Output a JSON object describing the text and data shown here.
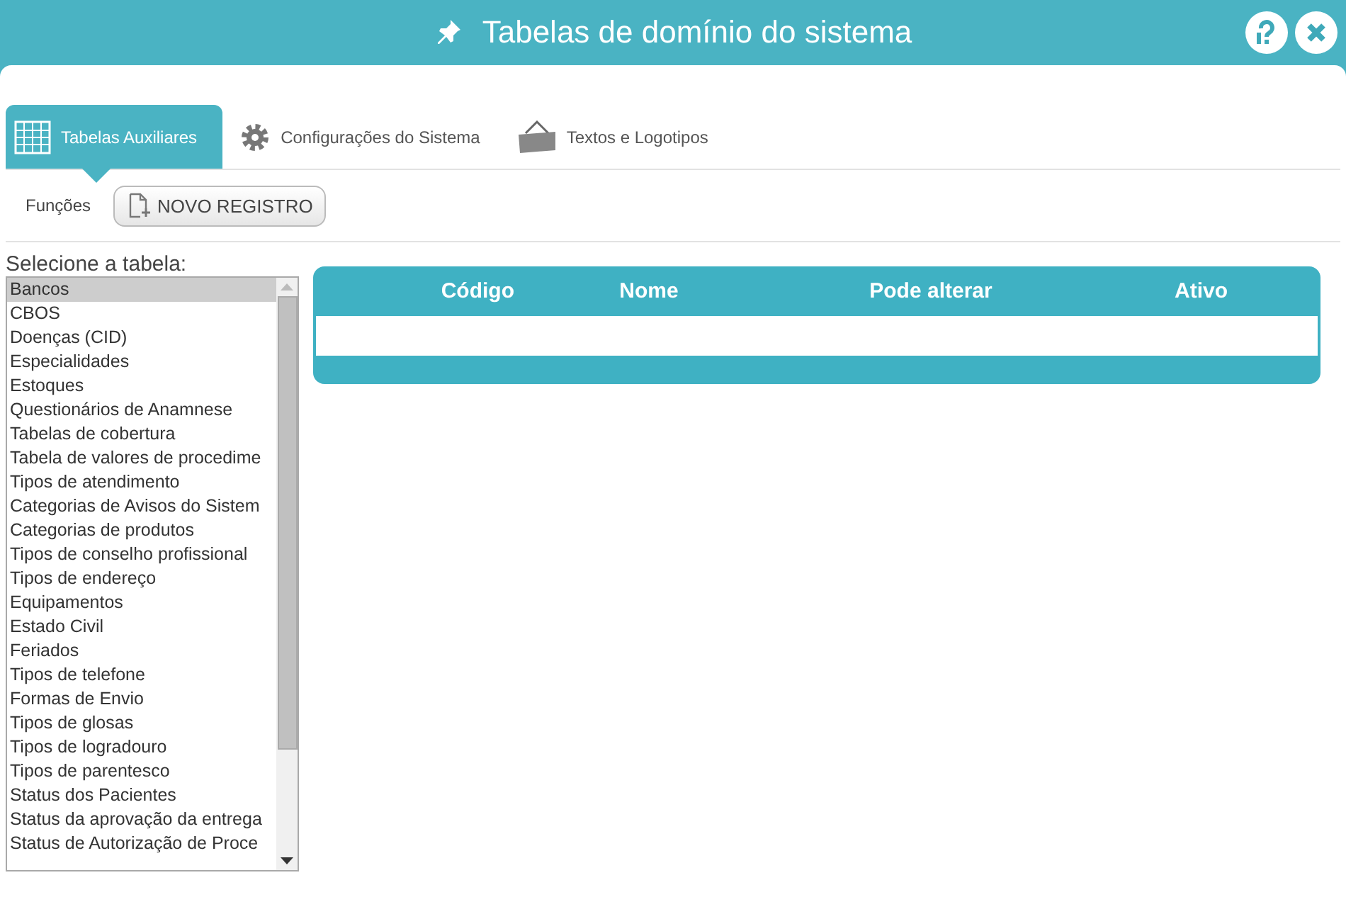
{
  "window": {
    "title": "Tabelas de domínio do sistema"
  },
  "tabs": [
    {
      "label": "Tabelas Auxiliares",
      "kind": "grid",
      "selected": true
    },
    {
      "label": "Configurações do Sistema",
      "kind": "gear",
      "selected": false
    },
    {
      "label": "Textos e Logotipos",
      "kind": "sign",
      "selected": false
    }
  ],
  "toolbar": {
    "label": "Funções",
    "button": "NOVO REGISTRO"
  },
  "table_list": {
    "label": "Selecione a tabela:",
    "items": [
      {
        "label": "Bancos",
        "selected": true
      },
      {
        "label": "CBOS",
        "selected": false
      },
      {
        "label": "Doenças (CID)",
        "selected": false
      },
      {
        "label": "Especialidades",
        "selected": false
      },
      {
        "label": "Estoques",
        "selected": false
      },
      {
        "label": "Questionários de Anamnese",
        "selected": false
      },
      {
        "label": "Tabelas de cobertura",
        "selected": false
      },
      {
        "label": "Tabela de valores de procedime",
        "selected": false
      },
      {
        "label": "Tipos de atendimento",
        "selected": false
      },
      {
        "label": "Categorias de Avisos do Sistem",
        "selected": false
      },
      {
        "label": "Categorias de produtos",
        "selected": false
      },
      {
        "label": "Tipos de conselho profissional",
        "selected": false
      },
      {
        "label": "Tipos de endereço",
        "selected": false
      },
      {
        "label": "Equipamentos",
        "selected": false
      },
      {
        "label": "Estado Civil",
        "selected": false
      },
      {
        "label": "Feriados",
        "selected": false
      },
      {
        "label": "Tipos de telefone",
        "selected": false
      },
      {
        "label": "Formas de Envio",
        "selected": false
      },
      {
        "label": "Tipos de glosas",
        "selected": false
      },
      {
        "label": "Tipos de logradouro",
        "selected": false
      },
      {
        "label": "Tipos de parentesco",
        "selected": false
      },
      {
        "label": "Status dos Pacientes",
        "selected": false
      },
      {
        "label": "Status da aprovação da entrega",
        "selected": false
      },
      {
        "label": "Status de Autorização de Proce",
        "selected": false
      }
    ]
  },
  "table": {
    "columns": [
      "Código",
      "Nome",
      "Pode alterar",
      "Ativo"
    ]
  }
}
